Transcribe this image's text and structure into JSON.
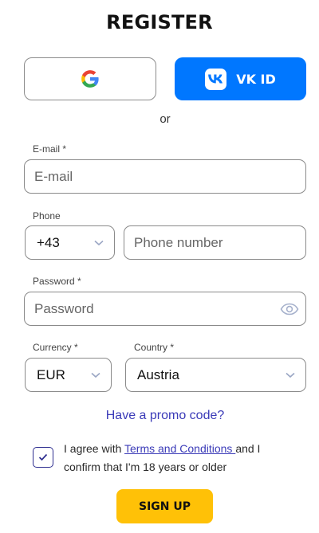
{
  "title": "REGISTER",
  "social": {
    "google_icon": "google-g-logo",
    "vk_icon": "vk-logo",
    "vk_label": "VK ID",
    "vk_color": "#0077ff"
  },
  "divider_text": "or",
  "email": {
    "label": "E-mail",
    "required_mark": "*",
    "placeholder": "E-mail"
  },
  "phone": {
    "label": "Phone",
    "code": "+43",
    "placeholder": "Phone number"
  },
  "password": {
    "label": "Password",
    "required_mark": "*",
    "placeholder": "Password",
    "icon": "eye-icon"
  },
  "currency": {
    "label": "Currency",
    "required_mark": "*",
    "value": "EUR"
  },
  "country": {
    "label": "Country",
    "required_mark": "*",
    "value": "Austria"
  },
  "promo_link": "Have a promo code?",
  "agreement": {
    "checked": true,
    "prefix": "I agree with ",
    "link": "Terms and Conditions ",
    "suffix": "and I confirm that I'm 18 years or older"
  },
  "signup_label": "SIGN UP",
  "colors": {
    "accent": "#0077ff",
    "link": "#3b3bb8",
    "cta": "#ffc107"
  }
}
